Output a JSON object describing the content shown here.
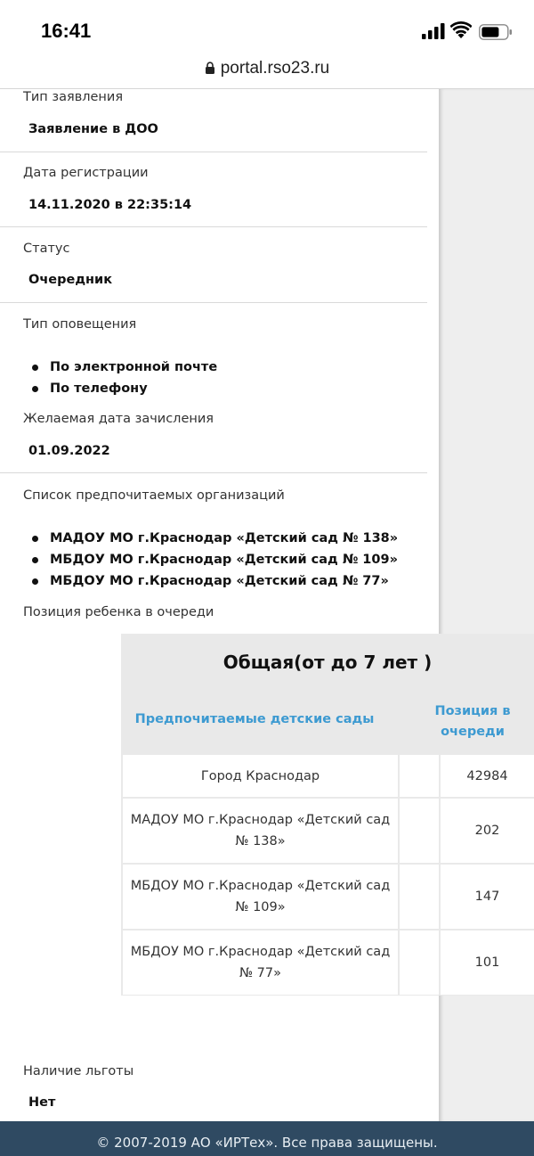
{
  "status_bar": {
    "time": "16:41"
  },
  "browser": {
    "url": "portal.rso23.ru"
  },
  "application": {
    "type_label": "Тип заявления",
    "type_value": "Заявление в ДОО",
    "reg_date_label": "Дата регистрации",
    "reg_date_value": "14.11.2020 в 22:35:14",
    "status_label": "Статус",
    "status_value": "Очередник",
    "notify_label": "Тип оповещения",
    "notify_items": [
      "По электронной почте",
      "По телефону"
    ],
    "enroll_date_label": "Желаемая дата зачисления",
    "enroll_date_value": "01.09.2022",
    "orgs_label": "Список предпочитаемых организаций",
    "orgs": [
      "МАДОУ МО г.Краснодар «Детский сад № 138»",
      "МБДОУ МО г.Краснодар «Детский сад № 109»",
      "МБДОУ МО г.Краснодар «Детский сад № 77»"
    ],
    "position_label": "Позиция ребенка в очереди",
    "benefit_label": "Наличие льготы",
    "benefit_value": "Нет"
  },
  "queue_table": {
    "title": "Общая(от до 7 лет )",
    "col_name": "Предпочитаемые детские сады",
    "col_position": "Позиция в очереди",
    "rows": [
      {
        "name": "Город Краснодар",
        "position": "42984"
      },
      {
        "name": "МАДОУ МО г.Краснодар «Детский сад № 138»",
        "position": "202"
      },
      {
        "name": "МБДОУ МО г.Краснодар «Детский сад № 109»",
        "position": "147"
      },
      {
        "name": "МБДОУ МО г.Краснодар «Детский сад № 77»",
        "position": "101"
      }
    ]
  },
  "footer": {
    "text": "© 2007-2019 АО «ИРТех». Все права защищены."
  },
  "colors": {
    "accent": "#3d9ad1",
    "footer_bg": "#2f4a62"
  }
}
